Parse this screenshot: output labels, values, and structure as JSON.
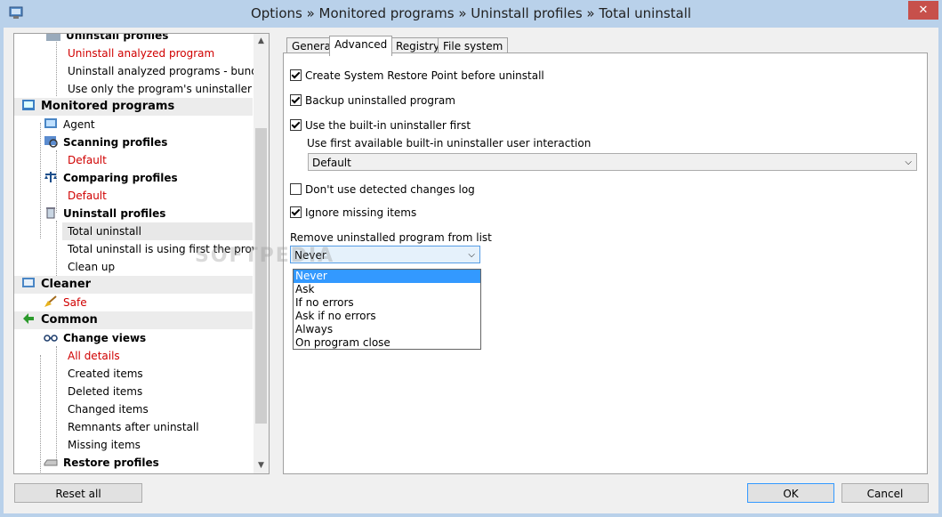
{
  "window": {
    "title": "Options » Monitored programs » Uninstall profiles » Total uninstall",
    "close_label": "✕"
  },
  "tree": {
    "rows": [
      {
        "label": "Uninstall profiles",
        "style": "bold"
      },
      {
        "label": "Uninstall analyzed program",
        "style": "red"
      },
      {
        "label": "Uninstall analyzed programs - bundle",
        "style": ""
      },
      {
        "label": "Use only the program's uninstaller",
        "style": ""
      },
      {
        "label": "Monitored programs",
        "style": "group"
      },
      {
        "label": "Agent",
        "style": ""
      },
      {
        "label": "Scanning profiles",
        "style": "bold"
      },
      {
        "label": "Default",
        "style": "red"
      },
      {
        "label": "Comparing profiles",
        "style": "bold"
      },
      {
        "label": "Default",
        "style": "red"
      },
      {
        "label": "Uninstall profiles",
        "style": "bold"
      },
      {
        "label": "Total uninstall",
        "style": "sel"
      },
      {
        "label": "Total uninstall is using first the provid...",
        "style": ""
      },
      {
        "label": "Clean up",
        "style": ""
      },
      {
        "label": "Cleaner",
        "style": "group"
      },
      {
        "label": "Safe",
        "style": "red"
      },
      {
        "label": "Common",
        "style": "group"
      },
      {
        "label": "Change views",
        "style": "bold"
      },
      {
        "label": "All details",
        "style": "red"
      },
      {
        "label": "Created items",
        "style": ""
      },
      {
        "label": "Deleted items",
        "style": ""
      },
      {
        "label": "Changed items",
        "style": ""
      },
      {
        "label": "Remnants after uninstall",
        "style": ""
      },
      {
        "label": "Missing items",
        "style": ""
      },
      {
        "label": "Restore profiles",
        "style": "bold"
      }
    ]
  },
  "tabs": [
    {
      "label": "General"
    },
    {
      "label": "Advanced"
    },
    {
      "label": "Registry"
    },
    {
      "label": "File system"
    }
  ],
  "options": {
    "restore_point": {
      "label": "Create System Restore Point before uninstall",
      "checked": true
    },
    "backup": {
      "label": "Backup uninstalled program",
      "checked": true
    },
    "builtin_first": {
      "label": "Use the built-in uninstaller first",
      "checked": true
    },
    "interaction_label": "Use first available built-in uninstaller user interaction",
    "interaction_value": "Default",
    "dont_use_log": {
      "label": "Don't use detected changes log",
      "checked": false
    },
    "ignore_missing": {
      "label": "Ignore missing items",
      "checked": true
    },
    "remove_label": "Remove uninstalled program from list",
    "remove_value": "Never",
    "remove_options": [
      "Never",
      "Ask",
      "If no errors",
      "Ask if no errors",
      "Always",
      "On program close"
    ]
  },
  "buttons": {
    "reset": "Reset all",
    "ok": "OK",
    "cancel": "Cancel"
  },
  "watermark": "SOFTPEDIA"
}
